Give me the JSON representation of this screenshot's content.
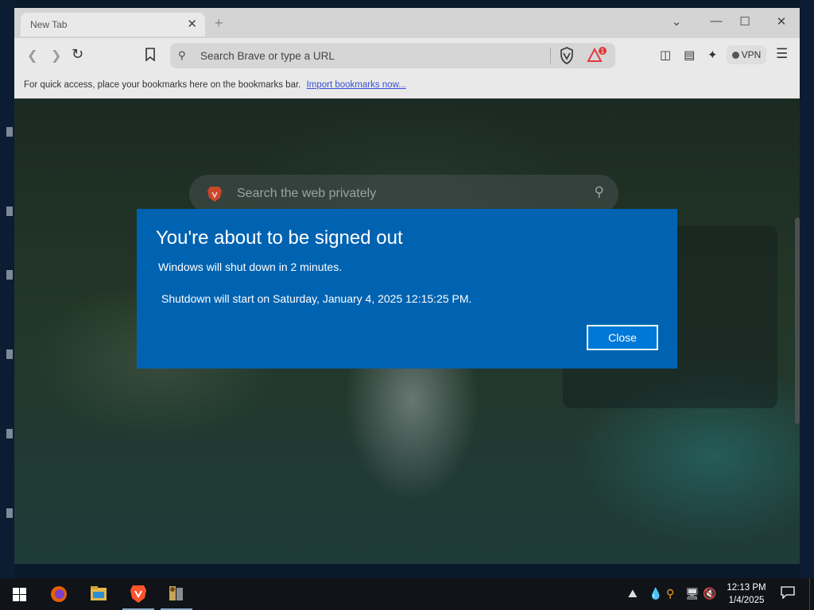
{
  "browser": {
    "tab_title": "New Tab",
    "tab_close": "✕",
    "new_tab": "+",
    "window_controls": {
      "list": "⌄",
      "minimize": "—",
      "maximize": "☐",
      "close": "✕"
    },
    "url_placeholder": "Search Brave or type a URL",
    "rewards_badge": "1",
    "vpn_label": "VPN",
    "bookmarks_bar_text": "For quick access, place your bookmarks here on the bookmarks bar.",
    "bookmarks_bar_link": "Import bookmarks now...",
    "ntp_search_placeholder": "Search the web privately"
  },
  "dialog": {
    "title": "You're about to be signed out",
    "message": "Windows will shut down in 2 minutes.",
    "detail": "Shutdown will start on Saturday, January 4, 2025 12:15:25 PM.",
    "close_label": "Close"
  },
  "taskbar": {
    "apps": [
      "firefox-icon",
      "file-explorer-icon",
      "brave-icon",
      "app-icon"
    ],
    "tray_icons": [
      "network-icon",
      "drop-icon",
      "search-icon",
      "display-icon",
      "volume-muted-icon"
    ],
    "clock_time": "12:13 PM",
    "clock_date": "1/4/2025"
  },
  "colors": {
    "dialog_bg": "#0063b1",
    "dialog_button": "#0078d7",
    "taskbar_bg": "#101318",
    "brave_orange": "#fb542b"
  }
}
